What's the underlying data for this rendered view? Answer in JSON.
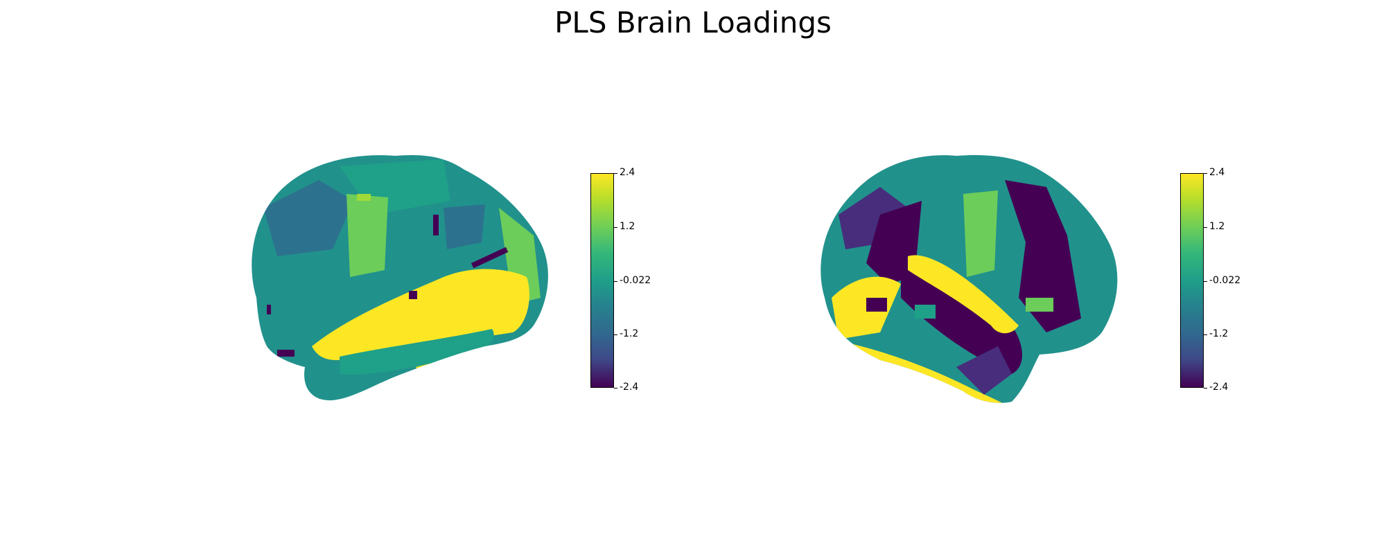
{
  "title": "PLS Brain Loadings",
  "colormap": "viridis",
  "colors": {
    "dark_purple": "#440154",
    "purple": "#472d7b",
    "blue_teal": "#2c728e",
    "teal": "#21918c",
    "green_teal": "#1fa088",
    "green": "#6ccd5a",
    "light_green": "#a0da39",
    "yellow": "#fde725"
  },
  "views": [
    {
      "name": "lateral-left-hemisphere"
    },
    {
      "name": "lateral-right-hemisphere"
    }
  ],
  "colorbar": {
    "min": -2.4,
    "max": 2.4,
    "ticks": [
      "2.4",
      "1.2",
      "-0.022",
      "-1.2",
      "-2.4"
    ],
    "tick_values": [
      2.4,
      1.2,
      -0.022,
      -1.2,
      -2.4
    ]
  }
}
